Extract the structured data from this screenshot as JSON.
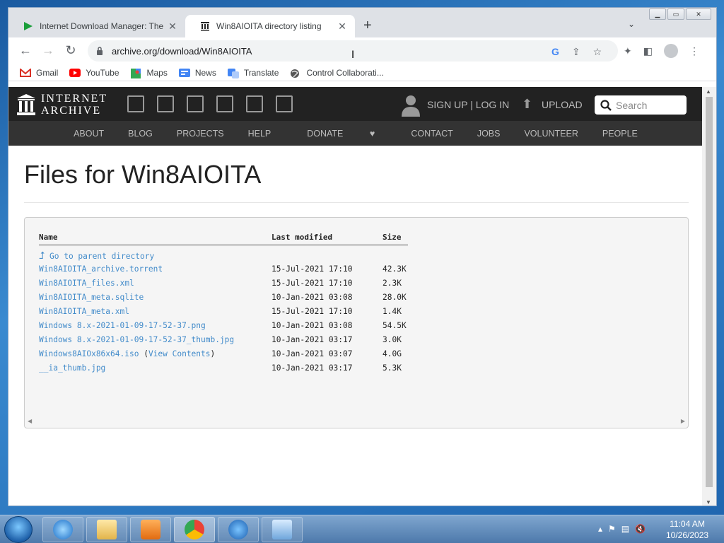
{
  "browser": {
    "tabs": [
      {
        "title": "Internet Download Manager: The",
        "active": false
      },
      {
        "title": "Win8AIOITA directory listing",
        "active": true
      }
    ],
    "url": "archive.org/download/Win8AIOITA",
    "bookmarks": [
      "Gmail",
      "YouTube",
      "Maps",
      "News",
      "Translate",
      "Control Collaborati..."
    ]
  },
  "ia": {
    "logo_line1": "INTERNET",
    "logo_line2": "ARCHIVE",
    "signup": "SIGN UP | LOG IN",
    "upload": "UPLOAD",
    "search_placeholder": "Search",
    "nav": [
      "ABOUT",
      "BLOG",
      "PROJECTS",
      "HELP",
      "DONATE",
      "CONTACT",
      "JOBS",
      "VOLUNTEER",
      "PEOPLE"
    ]
  },
  "listing": {
    "title": "Files for Win8AIOITA",
    "headers": {
      "name": "Name",
      "modified": "Last modified",
      "size": "Size"
    },
    "parent": "Go to parent directory",
    "rows": [
      {
        "name": "Win8AIOITA_archive.torrent",
        "date": "15-Jul-2021 17:10",
        "size": "42.3K"
      },
      {
        "name": "Win8AIOITA_files.xml",
        "date": "15-Jul-2021 17:10",
        "size": "2.3K"
      },
      {
        "name": "Win8AIOITA_meta.sqlite",
        "date": "10-Jan-2021 03:08",
        "size": "28.0K"
      },
      {
        "name": "Win8AIOITA_meta.xml",
        "date": "15-Jul-2021 17:10",
        "size": "1.4K"
      },
      {
        "name": "Windows 8.x-2021-01-09-17-52-37.png",
        "date": "10-Jan-2021 03:08",
        "size": "54.5K"
      },
      {
        "name": "Windows 8.x-2021-01-09-17-52-37_thumb.jpg",
        "date": "10-Jan-2021 03:17",
        "size": "3.0K"
      },
      {
        "name": "Windows8AIOx86x64.iso",
        "view": "View Contents",
        "date": "10-Jan-2021 03:07",
        "size": "4.0G"
      },
      {
        "name": "__ia_thumb.jpg",
        "date": "10-Jan-2021 03:17",
        "size": "5.3K"
      }
    ]
  },
  "taskbar": {
    "time": "11:04 AM",
    "date": "10/26/2023"
  },
  "colors": {
    "link": "#428bca",
    "ia_bar": "#222222",
    "ia_nav": "#333333"
  }
}
